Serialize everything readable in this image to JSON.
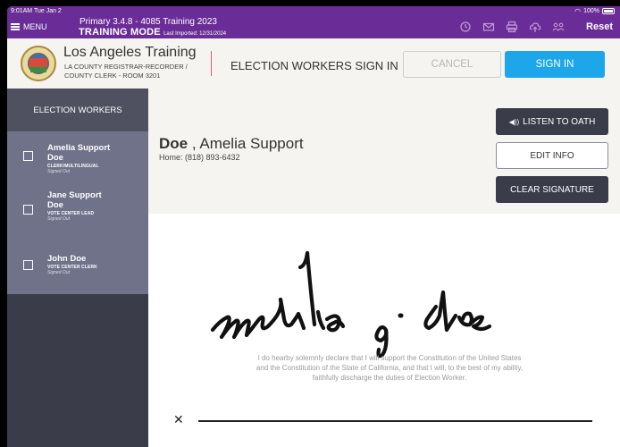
{
  "status_bar": {
    "time": "9:01AM  Tue Jan 2",
    "battery": "100%"
  },
  "topbar": {
    "menu_label": "MENU",
    "version": "Primary 3.4.8 - 4085 Training 2023",
    "mode": "TRAINING MODE",
    "last_imported": "Last Imported: 12/31/2024",
    "icons": [
      "history-icon",
      "mail-icon",
      "printer-icon",
      "cloud-upload-icon",
      "users-icon"
    ],
    "reset_label": "Reset",
    "brand_color": "#6a2c96"
  },
  "header": {
    "org_name": "Los Angeles Training",
    "org_sub1": "LA COUNTY REGISTRAR-RECORDER /",
    "org_sub2": "COUNTY CLERK - ROOM 3201",
    "page_title": "ELECTION WORKERS SIGN IN",
    "cancel_label": "CANCEL",
    "signin_label": "SIGN IN",
    "accent": "#1ea6ea"
  },
  "sidebar": {
    "heading": "ELECTION WORKERS",
    "workers": [
      {
        "name_line1": "Amelia Support",
        "name_line2": "Doe",
        "role": "CLERK/MULTILINGUAL",
        "status": "Signed Out",
        "checked": false
      },
      {
        "name_line1": "Jane Support",
        "name_line2": "Doe",
        "role": "VOTE CENTER LEAD",
        "status": "Signed Out",
        "checked": false
      },
      {
        "name_line1": "John  Doe",
        "name_line2": "",
        "role": "VOTE CENTER CLERK",
        "status": "Signed Out",
        "checked": false
      }
    ]
  },
  "main": {
    "last_name": "Doe",
    "rest_name": " , Amelia Support",
    "home_phone": "Home: (818) 893-6432",
    "listen_label": "LISTEN TO OATH",
    "edit_label": "EDIT INFO",
    "clear_label": "CLEAR SIGNATURE",
    "oath_line1": "I do hearby solemnly declare that I will support the Constitution of the United States",
    "oath_line2": "and the Constitution of the State of California, and that I will, to the best of my ability,",
    "oath_line3": "faithfully discharge the duties of Election Worker.",
    "x_mark": "✕"
  }
}
